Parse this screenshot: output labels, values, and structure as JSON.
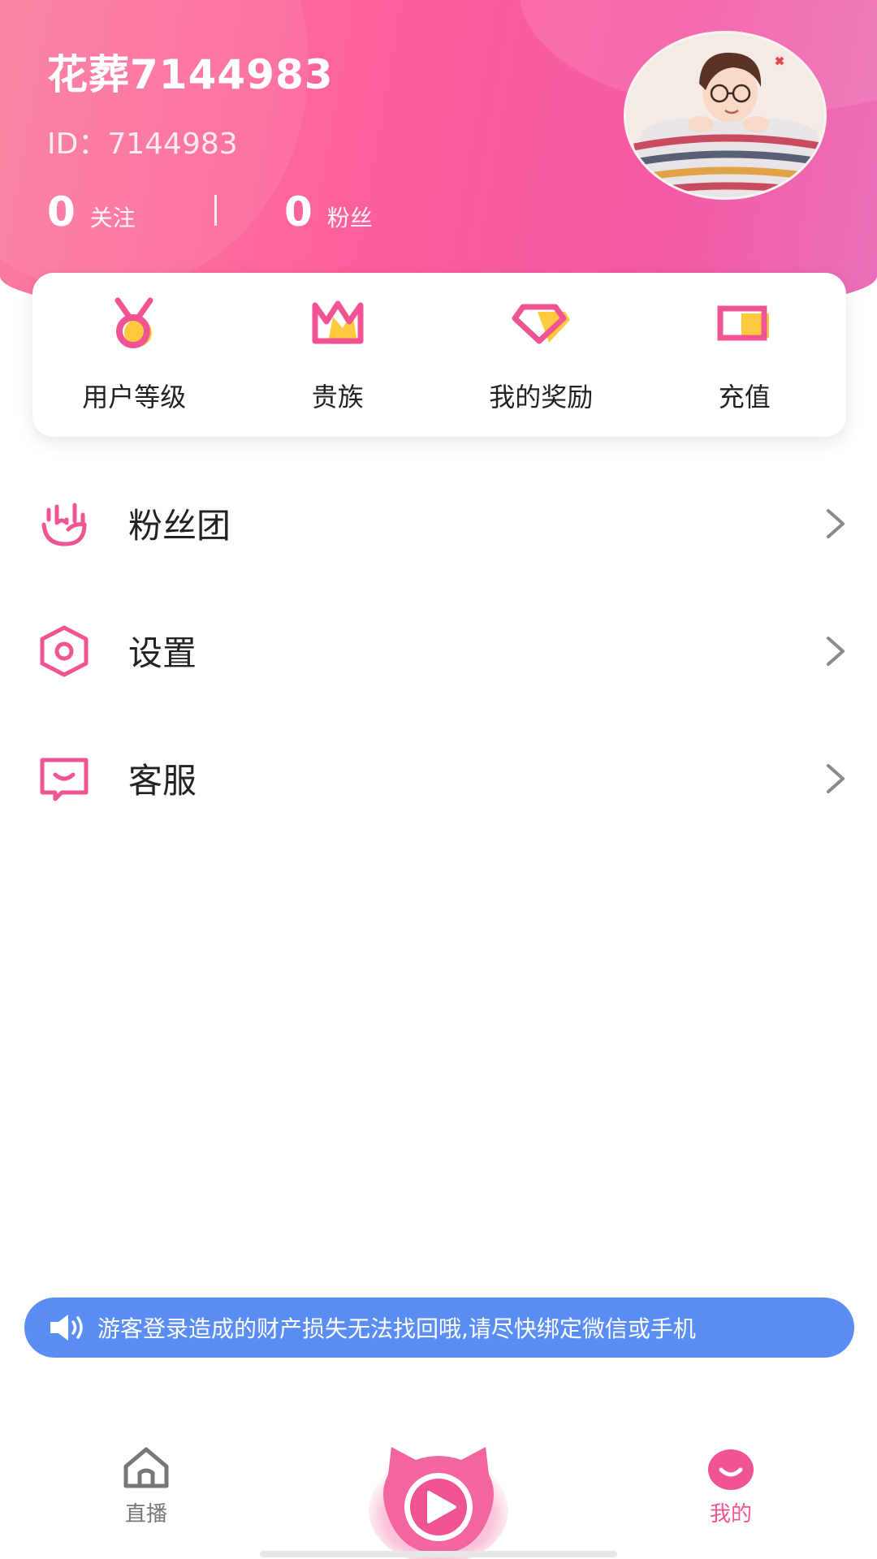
{
  "profile": {
    "username": "花葬7144983",
    "id_text": "ID：7144983",
    "following_count": "0",
    "following_label": "关注",
    "fans_count": "0",
    "fans_label": "粉丝"
  },
  "quick_actions": [
    {
      "label": "用户等级",
      "icon": "medal-icon"
    },
    {
      "label": "贵族",
      "icon": "crown-icon"
    },
    {
      "label": "我的奖励",
      "icon": "diamond-icon"
    },
    {
      "label": "充值",
      "icon": "battery-icon"
    }
  ],
  "menu": [
    {
      "label": "粉丝团",
      "icon": "hand-gesture-icon"
    },
    {
      "label": "设置",
      "icon": "hexagon-settings-icon"
    },
    {
      "label": "客服",
      "icon": "chat-smile-icon"
    }
  ],
  "notice": {
    "text": "游客登录造成的财产损失无法找回哦,请尽快绑定微信或手机",
    "icon": "speaker-icon"
  },
  "tabbar": {
    "live_label": "直播",
    "mine_label": "我的",
    "center_icon": "cat-play-icon"
  },
  "colors": {
    "accent_pink": "#f05493",
    "header_gradient_start": "#fb7c9e",
    "header_gradient_end": "#ea6fb8",
    "icon_yellow": "#ffc83d",
    "notice_blue": "#5b8ef5"
  }
}
